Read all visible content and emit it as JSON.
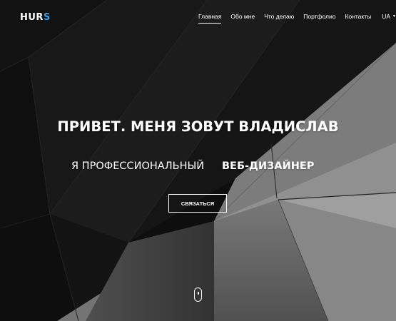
{
  "brand": {
    "logo_main": "HUR",
    "logo_accent": "S"
  },
  "nav": {
    "items": [
      {
        "label": "Главная",
        "active": true
      },
      {
        "label": "Обо мне",
        "active": false
      },
      {
        "label": "Что делаю",
        "active": false
      },
      {
        "label": "Портфолио",
        "active": false
      },
      {
        "label": "Контакты",
        "active": false
      }
    ],
    "language": "UA",
    "language_caret": "▼"
  },
  "hero": {
    "title": "ПРИВЕТ. МЕНЯ ЗОВУТ ВЛАДИСЛАВ",
    "subtitle_prefix": "Я ПРОФЕССИОНАЛЬНЫЙ",
    "subtitle_role": "ВЕБ-ДИЗАЙНЕР",
    "cta_label": "СВЯЗАТЬСЯ"
  },
  "colors": {
    "accent": "#3aa0e8",
    "text": "#ffffff"
  },
  "icons": {
    "scroll": "mouse-scroll-icon"
  }
}
